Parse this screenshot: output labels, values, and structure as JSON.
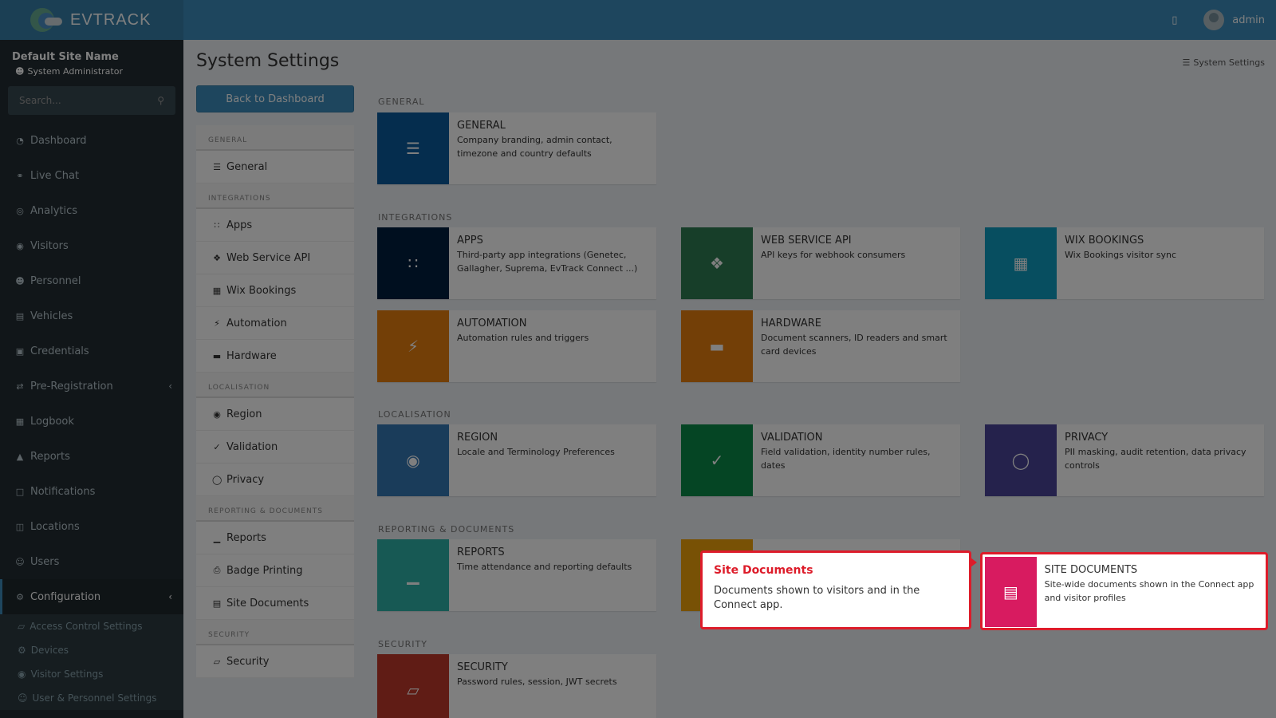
{
  "header": {
    "logo_text": "EVTRACK",
    "user_name": "admin"
  },
  "sidebar": {
    "site_name": "Default Site Name",
    "role": "System Administrator",
    "search_placeholder": "Search...",
    "items": [
      {
        "label": "Dashboard",
        "icon": "dashboard-icon"
      },
      {
        "label": "Live Chat",
        "icon": "headset-icon"
      },
      {
        "label": "Analytics",
        "icon": "target-icon"
      },
      {
        "label": "Visitors",
        "icon": "eye-icon"
      },
      {
        "label": "Personnel",
        "icon": "user-cog-icon"
      },
      {
        "label": "Vehicles",
        "icon": "car-icon"
      },
      {
        "label": "Credentials",
        "icon": "id-card-icon"
      },
      {
        "label": "Pre-Registration",
        "icon": "exchange-icon"
      },
      {
        "label": "Logbook",
        "icon": "book-icon"
      },
      {
        "label": "Reports",
        "icon": "chart-icon"
      },
      {
        "label": "Notifications",
        "icon": "comments-icon"
      },
      {
        "label": "Locations",
        "icon": "building-icon"
      },
      {
        "label": "Users",
        "icon": "users-icon"
      },
      {
        "label": "Configuration",
        "icon": "gear-icon"
      }
    ],
    "submenu": [
      {
        "label": "Access Control Settings"
      },
      {
        "label": "Devices"
      },
      {
        "label": "Visitor Settings"
      },
      {
        "label": "User & Personnel Settings"
      }
    ]
  },
  "page": {
    "title": "System Settings",
    "breadcrumb": "System Settings",
    "back_button": "Back to Dashboard"
  },
  "settings_nav": {
    "sections": [
      {
        "title": "GENERAL",
        "items": [
          "General"
        ]
      },
      {
        "title": "INTEGRATIONS",
        "items": [
          "Apps",
          "Web Service API",
          "Wix Bookings",
          "Automation",
          "Hardware"
        ]
      },
      {
        "title": "LOCALISATION",
        "items": [
          "Region",
          "Validation",
          "Privacy"
        ]
      },
      {
        "title": "REPORTING & DOCUMENTS",
        "items": [
          "Reports",
          "Badge Printing",
          "Site Documents"
        ]
      },
      {
        "title": "SECURITY",
        "items": [
          "Security"
        ]
      }
    ]
  },
  "grid": {
    "sections": {
      "general": "GENERAL",
      "integrations": "INTEGRATIONS",
      "localisation": "LOCALISATION",
      "reporting": "REPORTING & DOCUMENTS",
      "security": "SECURITY"
    },
    "cards": {
      "general": {
        "title": "GENERAL",
        "desc": "Company branding, admin contact, timezone and country defaults",
        "color": "#0a5a9c"
      },
      "apps": {
        "title": "APPS",
        "desc": "Third-party app integrations (Genetec, Gallagher, Suprema, EvTrack Connect ...)",
        "color": "#001f3f"
      },
      "webapi": {
        "title": "WEB SERVICE API",
        "desc": "API keys for webhook consumers",
        "color": "#2e7d52"
      },
      "wix": {
        "title": "WIX BOOKINGS",
        "desc": "Wix Bookings visitor sync",
        "color": "#0f9cc1"
      },
      "automation": {
        "title": "AUTOMATION",
        "desc": "Automation rules and triggers",
        "color": "#e67e0e"
      },
      "hardware": {
        "title": "HARDWARE",
        "desc": "Document scanners, ID readers and smart card devices",
        "color": "#e67e0e"
      },
      "region": {
        "title": "REGION",
        "desc": "Locale and Terminology Preferences",
        "color": "#3478b5"
      },
      "validation": {
        "title": "VALIDATION",
        "desc": "Field validation, identity number rules, dates",
        "color": "#0b8a48"
      },
      "privacy": {
        "title": "PRIVACY",
        "desc": "PII masking, audit retention, data privacy controls",
        "color": "#4b4599"
      },
      "reports": {
        "title": "REPORTS",
        "desc": "Time attendance and reporting defaults",
        "color": "#2fb3a8"
      },
      "badge": {
        "title": "",
        "desc": "",
        "color": "#f0a30a"
      },
      "site_documents": {
        "title": "SITE DOCUMENTS",
        "desc": "Site-wide documents shown in the Connect app and visitor profiles",
        "color": "#d81b60"
      },
      "security": {
        "title": "SECURITY",
        "desc": "Password rules, session, JWT secrets",
        "color": "#c0392b"
      }
    }
  },
  "tooltip": {
    "title": "Site Documents",
    "body": "Documents shown to visitors and in the Connect app."
  }
}
